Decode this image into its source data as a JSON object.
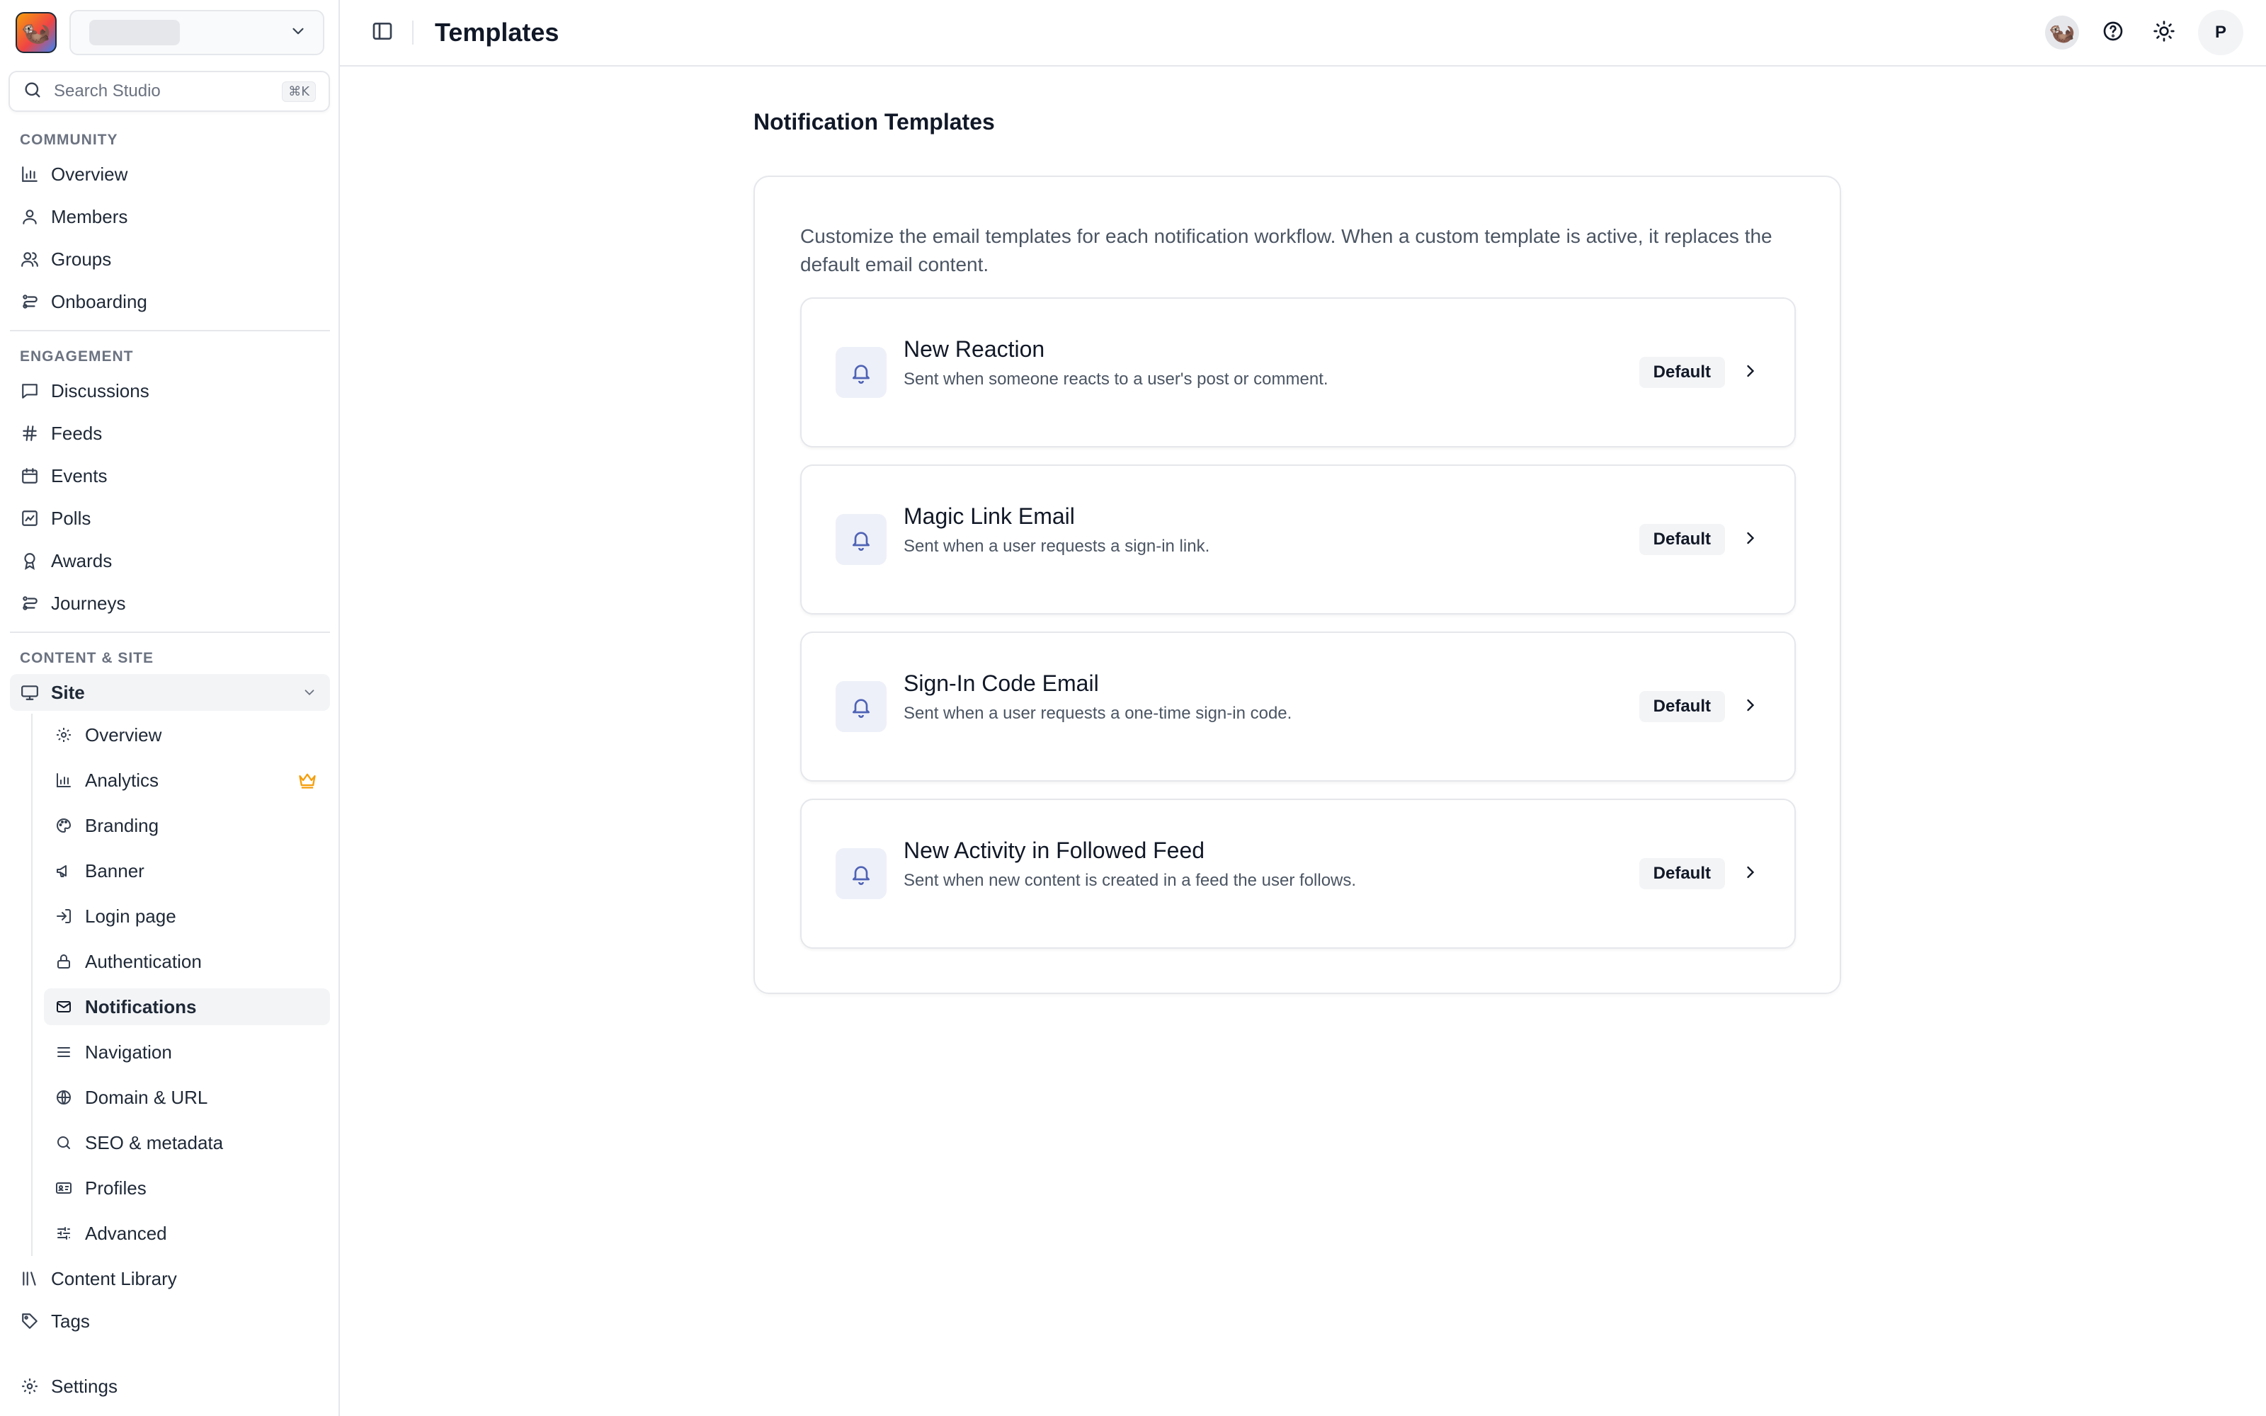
{
  "sidebar": {
    "search": {
      "placeholder": "Search Studio",
      "shortcut": "⌘K"
    },
    "sections": {
      "community": "COMMUNITY",
      "engagement": "ENGAGEMENT",
      "content_site": "CONTENT & SITE"
    },
    "community_items": [
      "Overview",
      "Members",
      "Groups",
      "Onboarding"
    ],
    "engagement_items": [
      "Discussions",
      "Feeds",
      "Events",
      "Polls",
      "Awards",
      "Journeys"
    ],
    "site_label": "Site",
    "site_items": [
      "Overview",
      "Analytics",
      "Branding",
      "Banner",
      "Login page",
      "Authentication",
      "Notifications",
      "Navigation",
      "Domain & URL",
      "SEO & metadata",
      "Profiles",
      "Advanced"
    ],
    "content_library": "Content Library",
    "tags": "Tags",
    "settings": "Settings"
  },
  "header": {
    "title": "Templates",
    "avatar_initial": "P"
  },
  "main": {
    "title": "Notification Templates",
    "description": "Customize the email templates for each notification workflow. When a custom template is active, it replaces the default email content.",
    "templates": [
      {
        "name": "New Reaction",
        "desc": "Sent when someone reacts to a user's post or comment.",
        "status": "Default"
      },
      {
        "name": "Magic Link Email",
        "desc": "Sent when a user requests a sign-in link.",
        "status": "Default"
      },
      {
        "name": "Sign-In Code Email",
        "desc": "Sent when a user requests a one-time sign-in code.",
        "status": "Default"
      },
      {
        "name": "New Activity in Followed Feed",
        "desc": "Sent when new content is created in a feed the user follows.",
        "status": "Default"
      }
    ]
  },
  "colors": {
    "accent_bell": "#4f63b5",
    "crown": "#f59e0b",
    "active_bg": "#f3f4f6"
  }
}
